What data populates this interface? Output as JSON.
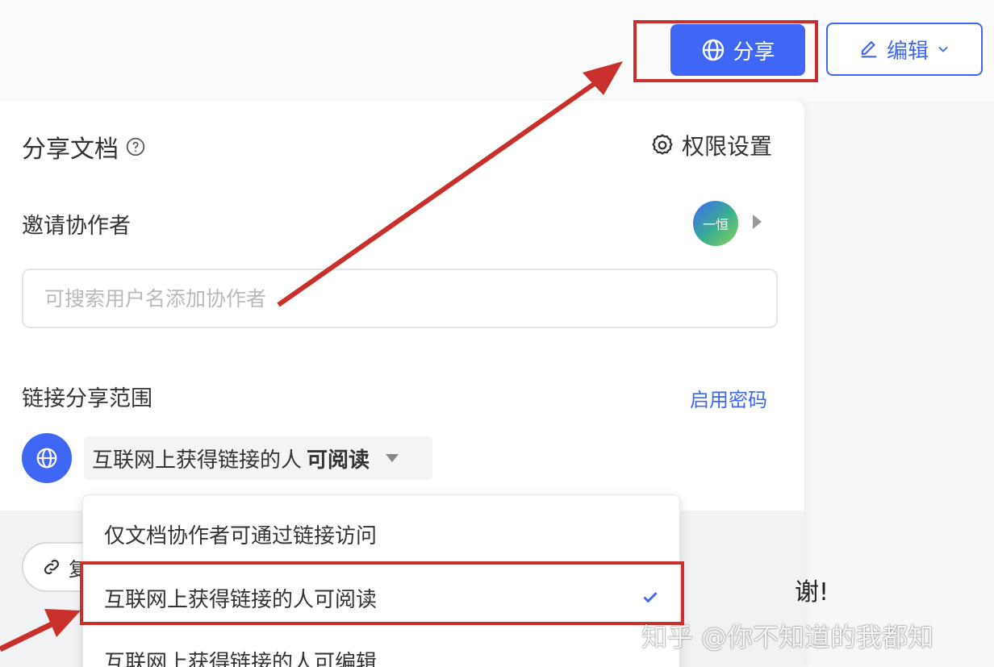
{
  "header": {
    "share_label": "分享",
    "edit_label": "编辑"
  },
  "panel": {
    "title": "分享文档",
    "permission_settings": "权限设置",
    "invite_label": "邀请协作者",
    "avatar_text": "一恒",
    "search_placeholder": "可搜索用户名添加协作者",
    "scope_label": "链接分享范围",
    "enable_password": "启用密码",
    "scope_selected_prefix": "互联网上获得链接的人",
    "scope_selected_bold": "可阅读",
    "copy_button_partial": "复"
  },
  "dropdown": {
    "options": [
      {
        "label": "仅文档协作者可通过链接访问",
        "selected": false
      },
      {
        "label": "互联网上获得链接的人可阅读",
        "selected": true
      },
      {
        "label": "互联网上获得链接的人可编辑",
        "selected": false
      }
    ]
  },
  "background_text": "谢!",
  "watermark": "知乎 @你不知道的我都知",
  "colors": {
    "accent": "#3f66f5",
    "annotation_red": "#c9302c"
  },
  "icons": [
    "globe-icon",
    "pencil-icon",
    "chevron-down-icon",
    "help-icon",
    "gear-icon",
    "chevron-right-icon",
    "link-icon",
    "check-icon"
  ]
}
